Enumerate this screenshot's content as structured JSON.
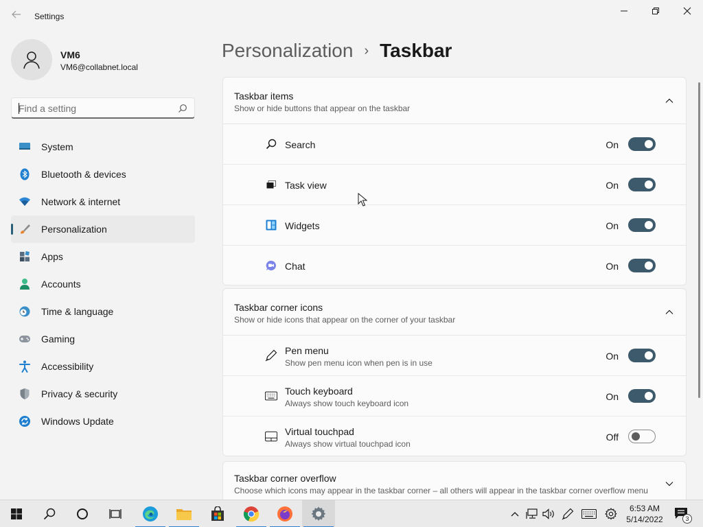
{
  "window": {
    "title": "Settings"
  },
  "profile": {
    "name": "VM6",
    "email": "VM6@collabnet.local"
  },
  "search": {
    "placeholder": "Find a setting"
  },
  "sidebar": {
    "items": [
      {
        "label": "System",
        "icon": "monitor-icon"
      },
      {
        "label": "Bluetooth & devices",
        "icon": "bluetooth-icon"
      },
      {
        "label": "Network & internet",
        "icon": "wifi-icon"
      },
      {
        "label": "Personalization",
        "icon": "brush-icon",
        "active": true
      },
      {
        "label": "Apps",
        "icon": "apps-icon"
      },
      {
        "label": "Accounts",
        "icon": "person-icon"
      },
      {
        "label": "Time & language",
        "icon": "clock-globe-icon"
      },
      {
        "label": "Gaming",
        "icon": "gamepad-icon"
      },
      {
        "label": "Accessibility",
        "icon": "accessibility-icon"
      },
      {
        "label": "Privacy & security",
        "icon": "shield-icon"
      },
      {
        "label": "Windows Update",
        "icon": "update-icon"
      }
    ]
  },
  "header": {
    "parent": "Personalization",
    "separator": "›",
    "current": "Taskbar"
  },
  "taskbar_items": {
    "title": "Taskbar items",
    "subtitle": "Show or hide buttons that appear on the taskbar",
    "rows": [
      {
        "label": "Search",
        "state": "On",
        "icon": "search-icon"
      },
      {
        "label": "Task view",
        "state": "On",
        "icon": "task-view-icon"
      },
      {
        "label": "Widgets",
        "state": "On",
        "icon": "widgets-icon"
      },
      {
        "label": "Chat",
        "state": "On",
        "icon": "chat-icon"
      }
    ]
  },
  "corner_icons": {
    "title": "Taskbar corner icons",
    "subtitle": "Show or hide icons that appear on the corner of your taskbar",
    "rows": [
      {
        "label": "Pen menu",
        "sub": "Show pen menu icon when pen is in use",
        "state": "On",
        "icon": "pen-icon"
      },
      {
        "label": "Touch keyboard",
        "sub": "Always show touch keyboard icon",
        "state": "On",
        "icon": "keyboard-icon"
      },
      {
        "label": "Virtual touchpad",
        "sub": "Always show virtual touchpad icon",
        "state": "Off",
        "icon": "touchpad-icon"
      }
    ]
  },
  "corner_overflow": {
    "title": "Taskbar corner overflow",
    "subtitle": "Choose which icons may appear in the taskbar corner – all others will appear in the taskbar corner overflow menu"
  },
  "system_taskbar": {
    "time": "6:53 AM",
    "date": "5/14/2022",
    "notification_count": "3",
    "apps": [
      "start-icon",
      "search-icon",
      "cortana-icon",
      "task-view-icon",
      "edge-icon",
      "file-explorer-icon",
      "store-icon",
      "chrome-icon",
      "firefox-icon",
      "settings-icon"
    ]
  },
  "colors": {
    "accent": "#3d5a6c",
    "background": "#f3f3f3",
    "card": "#fbfbfb"
  }
}
